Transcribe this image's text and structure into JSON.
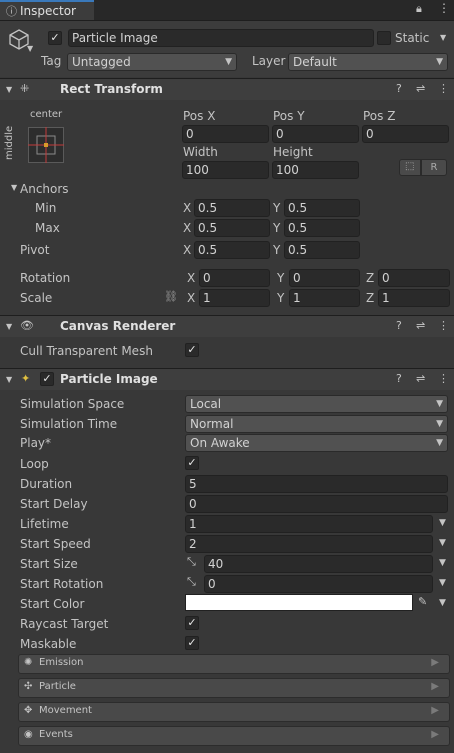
{
  "tab": {
    "title": "Inspector"
  },
  "object": {
    "name": "Particle Image",
    "static_label": "Static",
    "tag_label": "Tag",
    "tag_value": "Untagged",
    "layer_label": "Layer",
    "layer_value": "Default"
  },
  "rect_transform": {
    "title": "Rect Transform",
    "anchor_preset_top": "center",
    "anchor_preset_side": "middle",
    "pos_x_label": "Pos X",
    "pos_y_label": "Pos Y",
    "pos_z_label": "Pos Z",
    "pos_x": "0",
    "pos_y": "0",
    "pos_z": "0",
    "width_label": "Width",
    "height_label": "Height",
    "width": "100",
    "height": "100",
    "r_button": "R",
    "anchors_label": "Anchors",
    "min_label": "Min",
    "max_label": "Max",
    "min_x": "0.5",
    "min_y": "0.5",
    "max_x": "0.5",
    "max_y": "0.5",
    "pivot_label": "Pivot",
    "pivot_x": "0.5",
    "pivot_y": "0.5",
    "rotation_label": "Rotation",
    "rot_x": "0",
    "rot_y": "0",
    "rot_z": "0",
    "scale_label": "Scale",
    "scale_x": "1",
    "scale_y": "1",
    "scale_z": "1",
    "x": "X",
    "y": "Y",
    "z": "Z"
  },
  "canvas_renderer": {
    "title": "Canvas Renderer",
    "cull_label": "Cull Transparent Mesh"
  },
  "particle_image": {
    "title": "Particle Image",
    "simulation_space_label": "Simulation Space",
    "simulation_space": "Local",
    "simulation_time_label": "Simulation Time",
    "simulation_time": "Normal",
    "play_label": "Play*",
    "play": "On Awake",
    "loop_label": "Loop",
    "duration_label": "Duration",
    "duration": "5",
    "start_delay_label": "Start Delay",
    "start_delay": "0",
    "lifetime_label": "Lifetime",
    "lifetime": "1",
    "start_speed_label": "Start Speed",
    "start_speed": "2",
    "start_size_label": "Start Size",
    "start_size": "40",
    "start_rotation_label": "Start Rotation",
    "start_rotation": "0",
    "start_color_label": "Start Color",
    "start_color": "#ffffff",
    "raycast_label": "Raycast Target",
    "maskable_label": "Maskable"
  },
  "foldouts": [
    "Emission",
    "Particle",
    "Movement",
    "Events"
  ],
  "icons": [
    "lock-icon",
    "menu-icon",
    "cube-icon",
    "help-icon",
    "preset-icon",
    "kebab-icon",
    "eyedropper-icon",
    "link-icon",
    "move-icon"
  ]
}
